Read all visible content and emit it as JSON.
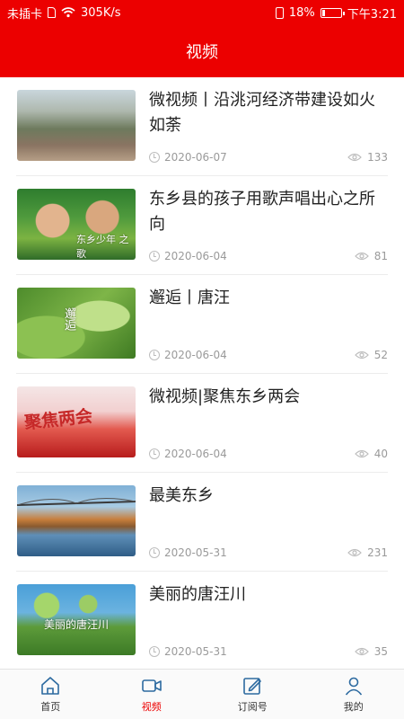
{
  "status_bar": {
    "carrier": "未插卡",
    "speed": "305K/s",
    "battery": "18%",
    "battery_level": 0.18,
    "time": "下午3:21"
  },
  "header": {
    "title": "视频"
  },
  "colors": {
    "accent": "#ec0000",
    "meta_text": "#9a9a9a"
  },
  "news": [
    {
      "title": "微视频丨沿洮河经济带建设如火如荼",
      "date": "2020-06-07",
      "views": "133",
      "thumb_icon": "city-river-thumbnail"
    },
    {
      "title": "东乡县的孩子用歌声唱出心之所向",
      "date": "2020-06-04",
      "views": "81",
      "thumb_icon": "children-singing-thumbnail",
      "thumb_text": "东乡少年 之歌"
    },
    {
      "title": "邂逅丨唐汪",
      "date": "2020-06-04",
      "views": "52",
      "thumb_icon": "green-leaves-thumbnail",
      "thumb_text": "邂逅"
    },
    {
      "title": "微视频|聚焦东乡两会",
      "date": "2020-06-04",
      "views": "40",
      "thumb_icon": "two-sessions-banner-thumbnail",
      "thumb_text": "聚焦两会"
    },
    {
      "title": "最美东乡",
      "date": "2020-05-31",
      "views": "231",
      "thumb_icon": "bridge-river-thumbnail"
    },
    {
      "title": "美丽的唐汪川",
      "date": "2020-05-31",
      "views": "35",
      "thumb_icon": "apricot-tree-thumbnail",
      "thumb_text": "美丽的唐汪川"
    }
  ],
  "tabs": [
    {
      "label": "首页",
      "icon": "home-icon",
      "active": false
    },
    {
      "label": "视频",
      "icon": "video-camera-icon",
      "active": true
    },
    {
      "label": "订阅号",
      "icon": "edit-icon",
      "active": false
    },
    {
      "label": "我的",
      "icon": "person-icon",
      "active": false
    }
  ]
}
